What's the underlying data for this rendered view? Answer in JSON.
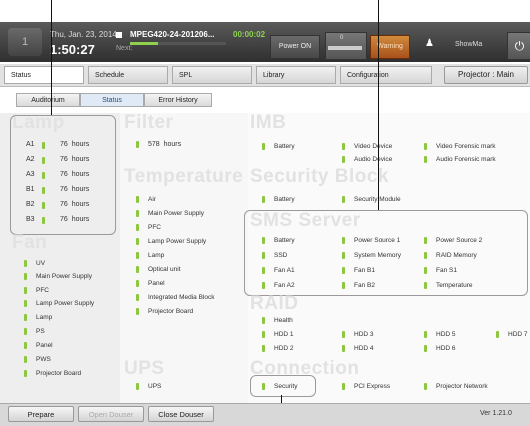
{
  "header": {
    "icon_label": "1",
    "date": "Thu, Jan. 23, 2014",
    "time": "1:50:27",
    "clip_name": "MPEG420-24-201206...",
    "clip_time": "00:00:02",
    "next_label": "Next:",
    "playback_progress_pct": 29,
    "power_status": "Power ON",
    "meter_value": "0",
    "warning_label": "Warning",
    "user_name": "ShowMa"
  },
  "tabs": [
    {
      "label": "Status"
    },
    {
      "label": "Schedule"
    },
    {
      "label": "SPL"
    },
    {
      "label": "Library"
    },
    {
      "label": "Configuration"
    }
  ],
  "projector_button": "Projector : Main",
  "subtabs": [
    {
      "label": "Auditorium"
    },
    {
      "label": "Status"
    },
    {
      "label": "Error History"
    }
  ],
  "lamp": {
    "title": "Lamp",
    "rows": [
      {
        "name": "A1",
        "value": "76",
        "unit": "hours"
      },
      {
        "name": "A2",
        "value": "76",
        "unit": "hours"
      },
      {
        "name": "A3",
        "value": "76",
        "unit": "hours"
      },
      {
        "name": "B1",
        "value": "76",
        "unit": "hours"
      },
      {
        "name": "B2",
        "value": "76",
        "unit": "hours"
      },
      {
        "name": "B3",
        "value": "76",
        "unit": "hours"
      }
    ]
  },
  "fan": {
    "title": "Fan",
    "items": [
      "UV",
      "Main Power Supply",
      "PFC",
      "Lamp Power Supply",
      "Lamp",
      "PS",
      "Panel",
      "PWS",
      "Projector Board"
    ]
  },
  "filter": {
    "title": "Filter",
    "value": "578",
    "unit": "hours"
  },
  "temperature": {
    "title": "Temperature",
    "items": [
      "Air",
      "Main Power Supply",
      "PFC",
      "Lamp Power Supply",
      "Lamp",
      "Optical unit",
      "Panel",
      "Integrated Media Block",
      "Projector Board"
    ]
  },
  "ups": {
    "title": "UPS",
    "items": [
      "UPS"
    ]
  },
  "imb": {
    "title": "IMB",
    "items": [
      "Battery",
      "Video Device",
      "Video Forensic mark",
      "Audio Device",
      "Audio Forensic mark"
    ]
  },
  "security_block": {
    "title": "Security Block",
    "items": [
      "Battery",
      "Security Module"
    ]
  },
  "sms_server": {
    "title": "SMS Server",
    "items": [
      "Battery",
      "Power Source 1",
      "Power Source 2",
      "SSD",
      "System Memory",
      "RAID Memory",
      "Fan A1",
      "Fan B1",
      "Fan S1",
      "Fan A2",
      "Fan B2",
      "Temperature"
    ]
  },
  "raid": {
    "title": "RAID",
    "items": [
      "Health",
      "HDD 1",
      "HDD 3",
      "HDD 5",
      "HDD 7",
      "HDD 2",
      "HDD 4",
      "HDD 6"
    ]
  },
  "connection": {
    "title": "Connection",
    "items": [
      "Security",
      "PCI Express",
      "Projector Network"
    ]
  },
  "bottom": {
    "prepare": "Prepare",
    "open_douser": "Open Douser",
    "close_douser": "Close Douser",
    "version": "Ver 1.21.0"
  },
  "colors": {
    "status_ok": "#8dc63f",
    "warning": "#c0692a"
  }
}
